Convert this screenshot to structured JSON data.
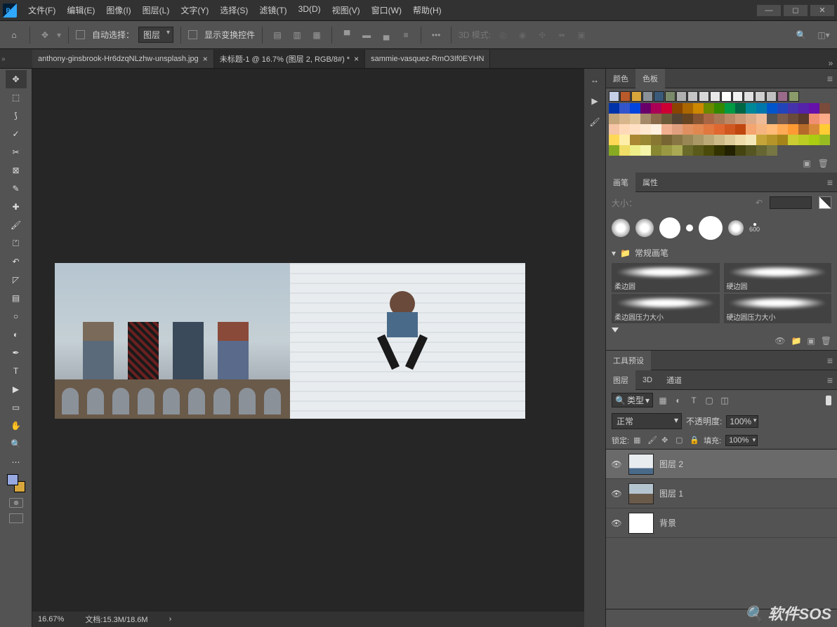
{
  "menu": {
    "items": [
      "文件(F)",
      "编辑(E)",
      "图像(I)",
      "图层(L)",
      "文字(Y)",
      "选择(S)",
      "滤镜(T)",
      "3D(D)",
      "视图(V)",
      "窗口(W)",
      "帮助(H)"
    ]
  },
  "options": {
    "auto_select_label": "自动选择：",
    "auto_select_value": "图层",
    "show_transform_label": "显示变换控件",
    "mode_3d_label": "3D 模式:"
  },
  "tabs": [
    {
      "name": "anthony-ginsbrook-Hr6dzqNLzhw-unsplash.jpg",
      "active": false
    },
    {
      "name": "未标题-1 @ 16.7% (图层 2, RGB/8#) *",
      "active": true
    },
    {
      "name": "sammie-vasquez-RmO3If0EYHN",
      "active": false
    }
  ],
  "status": {
    "zoom": "16.67%",
    "doc_label": "文档:",
    "doc_value": "15.3M/18.6M"
  },
  "panels": {
    "color_tab": "颜色",
    "swatches_tab": "色板",
    "brush_tab": "画笔",
    "props_tab": "属性",
    "brush_size_label": "大小：",
    "brush_max": "600",
    "brush_folder": "常规画笔",
    "brushes": [
      "柔边圆",
      "硬边圆",
      "柔边圆压力大小",
      "硬边圆压力大小"
    ],
    "toolpreset_tab": "工具预设",
    "layers_tab": "图层",
    "threeD_tab": "3D",
    "channels_tab": "通道",
    "kind_label": "类型",
    "blend_mode": "正常",
    "opacity_label": "不透明度:",
    "opacity_value": "100%",
    "lock_label": "锁定:",
    "fill_label": "填充:",
    "fill_value": "100%",
    "layers": [
      {
        "name": "图层 2",
        "selected": true
      },
      {
        "name": "图层 1",
        "selected": false
      },
      {
        "name": "背景",
        "selected": false
      }
    ]
  },
  "swatch_row1": [
    "#c5d0e6",
    "#b85a2a",
    "#d8a73c",
    "#8a9199",
    "#3a5a7a",
    "#7a8a6a",
    "#b0b0b0",
    "#c5c5c5",
    "#d8d8d8",
    "#e8e8e8",
    "#ffffff",
    "#f0f0f0",
    "#e0e0e0",
    "#d0d0d0",
    "#c0c0c0",
    "#9a6a8a",
    "#8a9a6a"
  ],
  "palette_colors": [
    "#0033aa",
    "#3355cc",
    "#0044dd",
    "#6a006a",
    "#aa0055",
    "#cc0033",
    "#884400",
    "#aa6600",
    "#cc8800",
    "#6a8800",
    "#338800",
    "#009944",
    "#006644",
    "#008899",
    "#0077aa",
    "#0055cc",
    "#2244bb",
    "#4433aa",
    "#5522aa",
    "#6611aa",
    "#7a4a3a",
    "#c5a57a",
    "#d8b58a",
    "#e0c59a",
    "#a58a6a",
    "#8a6a4a",
    "#6a5a3a",
    "#554433",
    "#664422",
    "#885533",
    "#aa6644",
    "#aa7755",
    "#bb8866",
    "#cc9977",
    "#ddaa88",
    "#eebb99",
    "#f0cc aa",
    "#7a5a4a",
    "#6a4a3a",
    "#5a3a2a",
    "#f09070",
    "#ffaa88",
    "#f5c5a5",
    "#ffd8b8",
    "#ffe0c5",
    "#ffe8d0",
    "#fff0e0",
    "#f0b090",
    "#e0a080",
    "#e09060",
    "#e08850",
    "#e07840",
    "#e06830",
    "#d05820",
    "#c04810",
    "#f5a570",
    "#f5b580",
    "#ffbb77",
    "#ffaa55",
    "#ff9933",
    "#b56a2a",
    "#d88a3a",
    "#ffcc33",
    "#ffd855",
    "#ffeeaa",
    "#aa8833",
    "#998833",
    "#887733",
    "#776633",
    "#887744",
    "#998855",
    "#aa9966",
    "#bbaa77",
    "#ccbb88",
    "#ddcc99",
    "#eeddaa",
    "#f5e8b8",
    "#c5a53a",
    "#b5952a",
    "#a5851a",
    "#cccc33",
    "#bbcc22",
    "#aacc11",
    "#99bb22",
    "#88aa22",
    "#eedd66",
    "#eeee88",
    "#f5f5aa",
    "#888833",
    "#999944",
    "#aaaa55",
    "#6a6a2a",
    "#5a5a1a",
    "#4a4a0a",
    "#333300",
    "#222200",
    "#444411",
    "#555522",
    "#666633",
    "#777744"
  ],
  "watermark": "软件SOS"
}
